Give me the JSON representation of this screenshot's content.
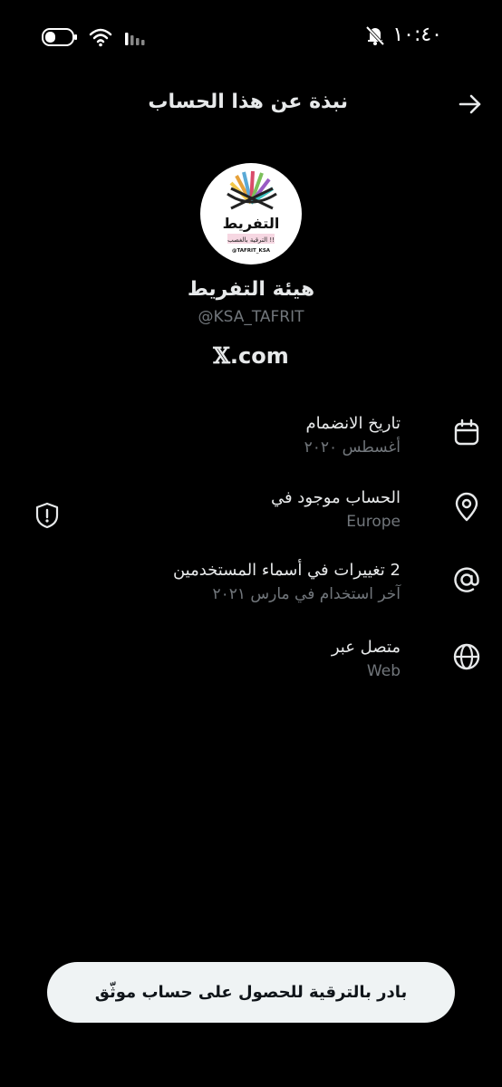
{
  "status_bar": {
    "time": "١٠:٤٠"
  },
  "header": {
    "title": "نبذة عن هذا الحساب"
  },
  "profile": {
    "display_name": "هيئة التفريط",
    "handle": "@KSA_TAFRIT",
    "link_suffix": ".com",
    "avatar_text": "التفريط",
    "avatar_subtext": "الترقية بالغصب !!",
    "avatar_tag": "@TAFRIT_KSA"
  },
  "info": [
    {
      "title": "تاريخ الانضمام",
      "sub": "أغسطس ٢٠٢٠",
      "icon": "calendar-icon"
    },
    {
      "title": "الحساب موجود في",
      "sub": "Europe",
      "icon": "location-pin-icon"
    },
    {
      "title": "2 تغييرات في أسماء المستخدمين",
      "sub": "آخر استخدام في مارس ٢٠٢١",
      "icon": "at-sign-icon"
    },
    {
      "title": "متصل عبر",
      "sub": "Web",
      "icon": "globe-icon"
    }
  ],
  "upgrade": {
    "label": "بادر بالترقية للحصول على حساب موثّق"
  },
  "colors": {
    "background": "#000000",
    "text": "#e7e9ea",
    "secondary": "#71767b",
    "button": "#eff3f4"
  }
}
